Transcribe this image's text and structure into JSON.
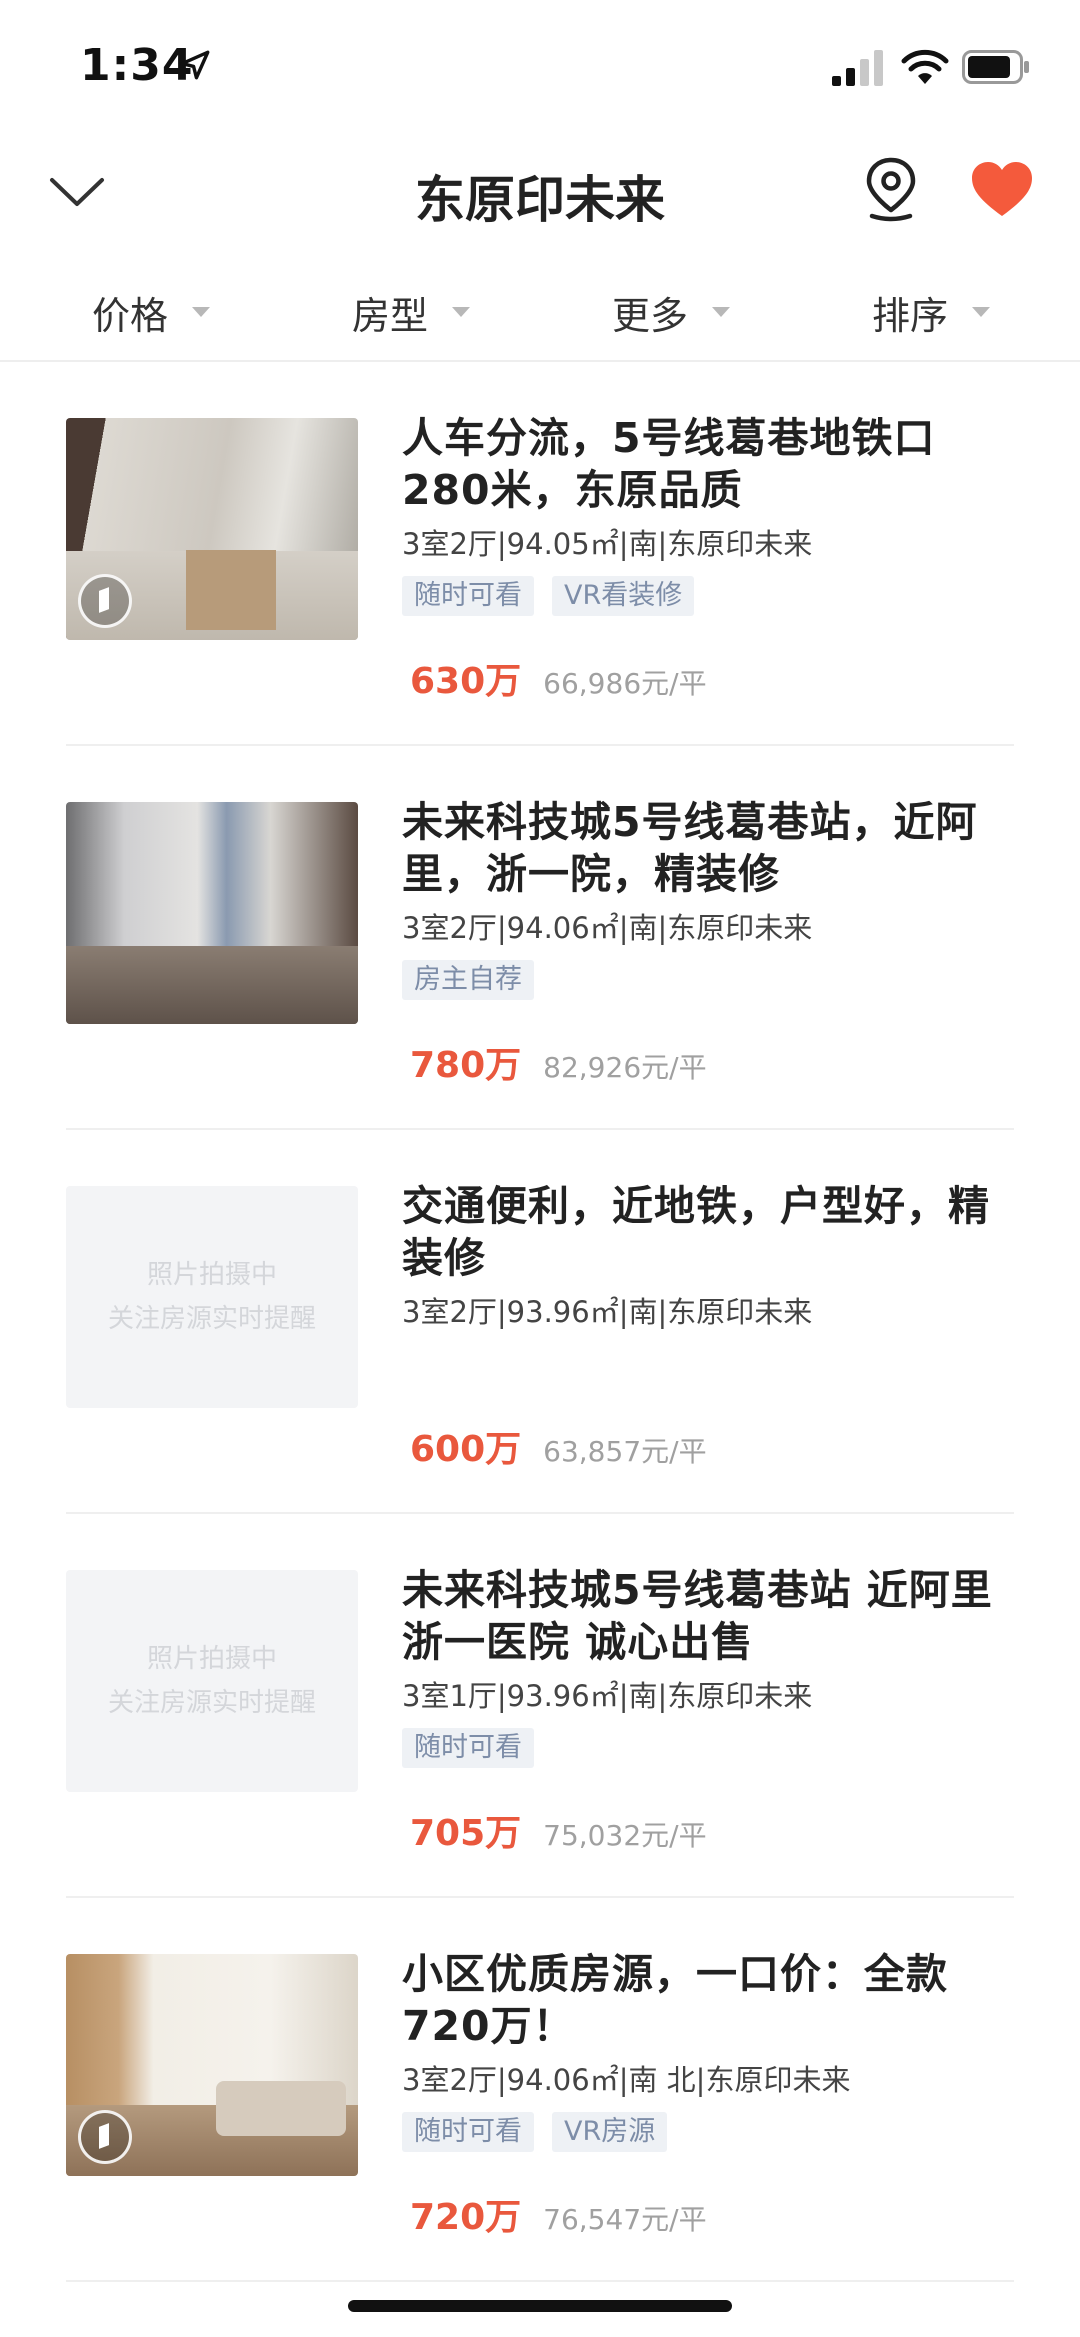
{
  "status_bar": {
    "time": "1:34"
  },
  "nav": {
    "title": "东原印未来"
  },
  "filters": [
    {
      "label": "价格"
    },
    {
      "label": "房型"
    },
    {
      "label": "更多"
    },
    {
      "label": "排序"
    }
  ],
  "listings": [
    {
      "title": "人车分流，5号线葛巷地铁口280米，东原品质",
      "meta": "3室2厅|94.05㎡|南|东原印未来",
      "tags": [
        "随时可看",
        "VR看装修"
      ],
      "price": "630万",
      "unit_price": "66,986元/平",
      "has_vr": true
    },
    {
      "title": "未来科技城5号线葛巷站，近阿里，浙一院，精装修",
      "meta": "3室2厅|94.06㎡|南|东原印未来",
      "tags": [
        "房主自荐"
      ],
      "price": "780万",
      "unit_price": "82,926元/平",
      "has_vr": false
    },
    {
      "title": "交通便利，近地铁，户型好，精装修",
      "meta": "3室2厅|93.96㎡|南|东原印未来",
      "tags": [],
      "price": "600万",
      "unit_price": "63,857元/平",
      "placeholder": [
        "照片拍摄中",
        "关注房源实时提醒"
      ],
      "has_vr": false
    },
    {
      "title": "未来科技城5号线葛巷站 近阿里 浙一医院 诚心出售",
      "meta": "3室1厅|93.96㎡|南|东原印未来",
      "tags": [
        "随时可看"
      ],
      "price": "705万",
      "unit_price": "75,032元/平",
      "placeholder": [
        "照片拍摄中",
        "关注房源实时提醒"
      ],
      "has_vr": false
    },
    {
      "title": "小区优质房源，一口价：全款720万！",
      "meta": "3室2厅|94.06㎡|南 北|东原印未来",
      "tags": [
        "随时可看",
        "VR房源"
      ],
      "price": "720万",
      "unit_price": "76,547元/平",
      "has_vr": true
    }
  ],
  "colors": {
    "price": "#e9583d",
    "heart": "#f45a3c",
    "tag_text": "#7d8da8",
    "tag_bg": "#eef1f5"
  }
}
